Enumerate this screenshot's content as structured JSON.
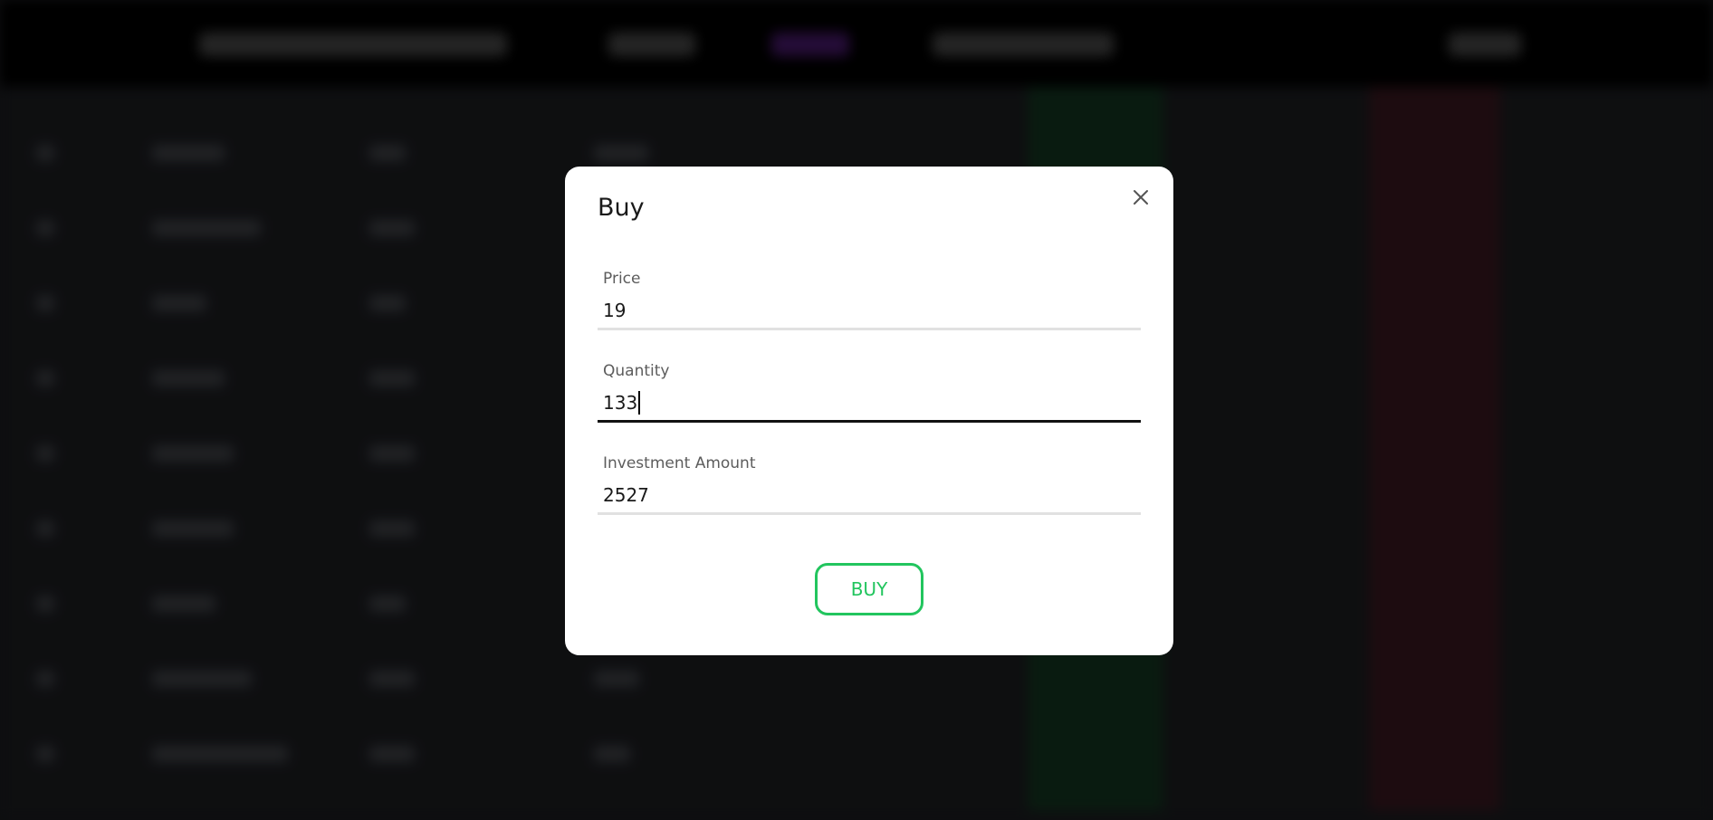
{
  "modal": {
    "title": "Buy",
    "close_icon": "close-icon",
    "fields": [
      {
        "label": "Price",
        "value": "19",
        "active": false
      },
      {
        "label": "Quantity",
        "value": "133",
        "active": true
      },
      {
        "label": "Investment Amount",
        "value": "2527",
        "active": false
      }
    ],
    "submit_label": "BUY"
  },
  "colors": {
    "accent_green": "#22c55e",
    "overlay": "#000000",
    "modal_bg": "#ffffff"
  }
}
